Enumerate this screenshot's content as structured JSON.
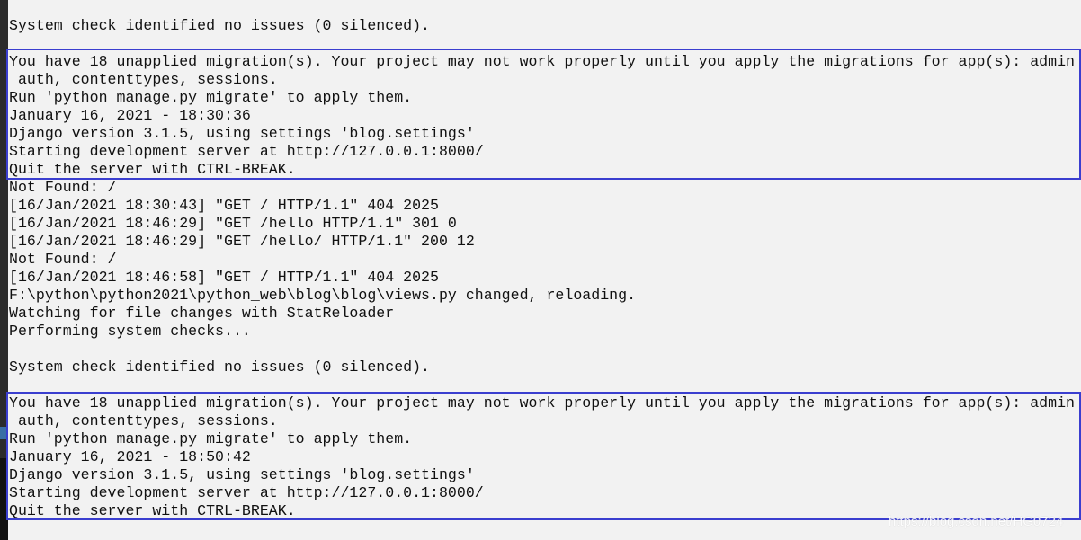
{
  "console_lines": [
    "System check identified no issues (0 silenced).",
    "",
    "You have 18 unapplied migration(s). Your project may not work properly until you apply the migrations for app(s): admin",
    " auth, contenttypes, sessions.",
    "Run 'python manage.py migrate' to apply them.",
    "January 16, 2021 - 18:30:36",
    "Django version 3.1.5, using settings 'blog.settings'",
    "Starting development server at http://127.0.0.1:8000/",
    "Quit the server with CTRL-BREAK.",
    "Not Found: /",
    "[16/Jan/2021 18:30:43] \"GET / HTTP/1.1\" 404 2025",
    "[16/Jan/2021 18:46:29] \"GET /hello HTTP/1.1\" 301 0",
    "[16/Jan/2021 18:46:29] \"GET /hello/ HTTP/1.1\" 200 12",
    "Not Found: /",
    "[16/Jan/2021 18:46:58] \"GET / HTTP/1.1\" 404 2025",
    "F:\\python\\python2021\\python_web\\blog\\blog\\views.py changed, reloading.",
    "Watching for file changes with StatReloader",
    "Performing system checks...",
    "",
    "System check identified no issues (0 silenced).",
    "",
    "You have 18 unapplied migration(s). Your project may not work properly until you apply the migrations for app(s): admin",
    " auth, contenttypes, sessions.",
    "Run 'python manage.py migrate' to apply them.",
    "January 16, 2021 - 18:50:42",
    "Django version 3.1.5, using settings 'blog.settings'",
    "Starting development server at http://127.0.0.1:8000/",
    "Quit the server with CTRL-BREAK."
  ],
  "watermark": "https://blog.csdn.net/HG0724",
  "colors": {
    "highlight_box": "#3a3ecf",
    "background": "#f2f2f2"
  }
}
